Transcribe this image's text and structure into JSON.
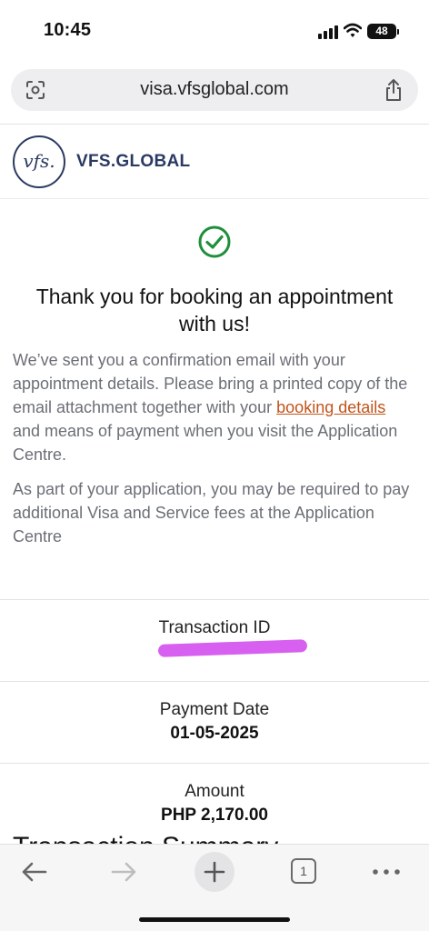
{
  "status_bar": {
    "time": "10:45",
    "battery": "48"
  },
  "browser": {
    "url": "visa.vfsglobal.com",
    "tab_count": "1"
  },
  "header": {
    "logo_mark": "vfs.",
    "logo_word": "VFS.GLOBAL"
  },
  "confirmation": {
    "title": "Thank you for booking an appointment with us!",
    "para1_before": "We’ve sent you a confirmation email with your appointment details. Please bring a printed copy of the email attachment together with your ",
    "para1_link": "booking details ",
    "para1_after": "and means of payment when you visit the Application Centre.",
    "para2": "As part of your application, you may be required to pay additional Visa and Service fees at the Application Centre"
  },
  "details": [
    {
      "label": "Transaction ID",
      "value": ""
    },
    {
      "label": "Payment Date",
      "value": "01-05-2025"
    },
    {
      "label": "Amount",
      "value": "PHP 2,170.00"
    }
  ],
  "summary_heading": "Transaction Summary",
  "colors": {
    "brand_navy": "#2b3a63",
    "success_green": "#1e8f3a",
    "link_orange": "#c2541c",
    "redaction": "#d860f0"
  },
  "icons": {
    "lens": "lens-icon",
    "share": "share-icon",
    "check": "check-circle-icon",
    "back": "arrow-left-icon",
    "forward": "arrow-right-icon",
    "new_tab": "plus-icon",
    "tabs": "tabs-icon",
    "more": "more-icon"
  }
}
